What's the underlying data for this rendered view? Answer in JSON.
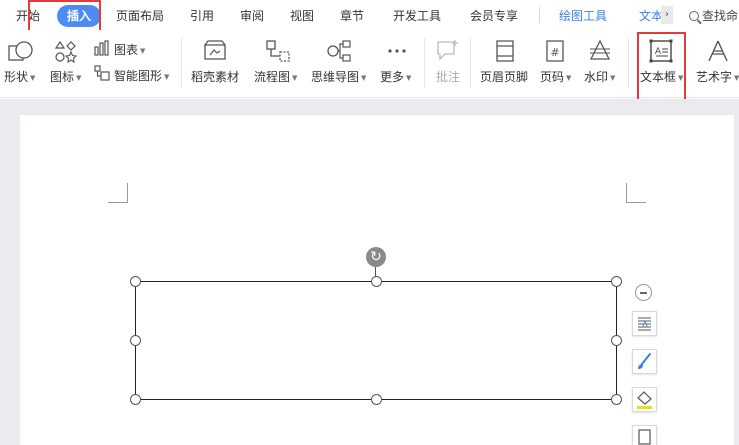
{
  "tabs": [
    {
      "label": "开始",
      "active": false
    },
    {
      "label": "插入",
      "active": true
    },
    {
      "label": "页面布局",
      "active": false
    },
    {
      "label": "引用",
      "active": false
    },
    {
      "label": "审阅",
      "active": false
    },
    {
      "label": "视图",
      "active": false
    },
    {
      "label": "章节",
      "active": false
    },
    {
      "label": "开发工具",
      "active": false
    },
    {
      "label": "会员专享",
      "active": false
    },
    {
      "label": "绘图工具",
      "active": false
    },
    {
      "label": "文本",
      "active": false
    }
  ],
  "search_label": "查找命",
  "ribbon": {
    "shapes": "形状",
    "icons": "图标",
    "chart": "图表",
    "smart_graphic": "智能图形",
    "docer_material": "稻壳素材",
    "flowchart": "流程图",
    "mindmap": "思维导图",
    "more": "更多",
    "comment": "批注",
    "header_footer": "页眉页脚",
    "page_number": "页码",
    "watermark": "水印",
    "textbox": "文本框",
    "wordart": "艺术字"
  },
  "colors": {
    "accent": "#4e8cf5",
    "highlight": "#e23b3b",
    "canvas_bg": "#e9ebee"
  }
}
